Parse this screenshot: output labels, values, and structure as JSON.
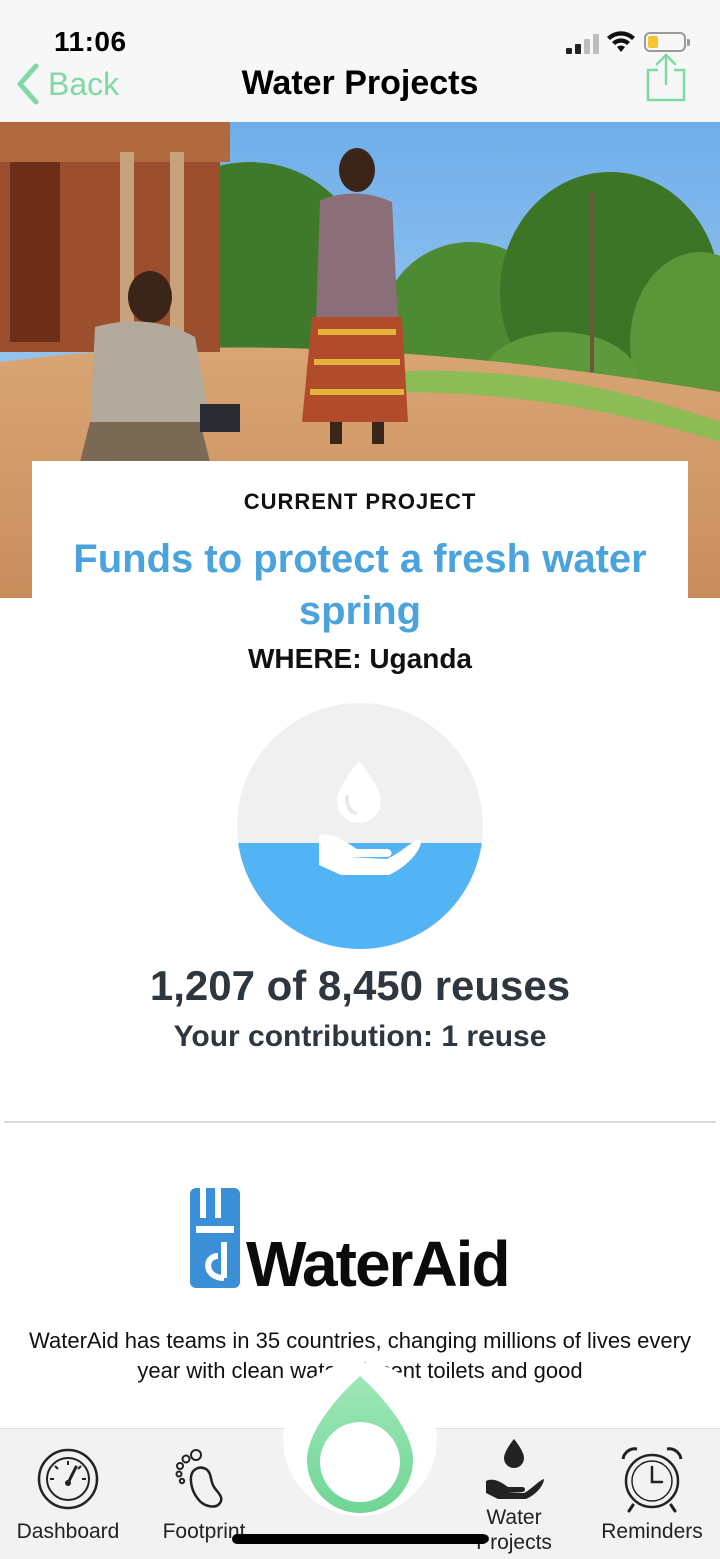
{
  "status_bar": {
    "time": "11:06",
    "battery_level": 0.3,
    "battery_color": "#f5c531"
  },
  "nav": {
    "back_label": "Back",
    "title": "Water Projects",
    "accent_color": "#7fd9a3",
    "share_icon": "share-icon"
  },
  "project": {
    "eyebrow": "CURRENT PROJECT",
    "title": "Funds to protect a fresh water spring",
    "where": "WHERE: Uganda",
    "title_color": "#4aa3dc"
  },
  "progress": {
    "current": 1207,
    "goal": 8450,
    "count_text": "1,207 of 8,450 reuses",
    "contribution_text": "Your contribution: 1 reuse",
    "fill_color": "#52b3f5",
    "icon": "water-drop-hand-icon"
  },
  "partner": {
    "name": "WaterAid",
    "logo_color": "#3a8fd6",
    "description": "WaterAid has teams in 35 countries, changing millions of lives every year with clean water, decent toilets and good"
  },
  "tabs": [
    {
      "label": "Dashboard",
      "icon": "speedometer-icon"
    },
    {
      "label": "Footprint",
      "icon": "footprint-icon"
    },
    {
      "label": "Water Projects",
      "icon": "water-hand-icon"
    },
    {
      "label": "Reminders",
      "icon": "alarm-clock-icon"
    }
  ],
  "fab": {
    "icon": "water-drop-icon",
    "color": "#7fd9a3"
  }
}
